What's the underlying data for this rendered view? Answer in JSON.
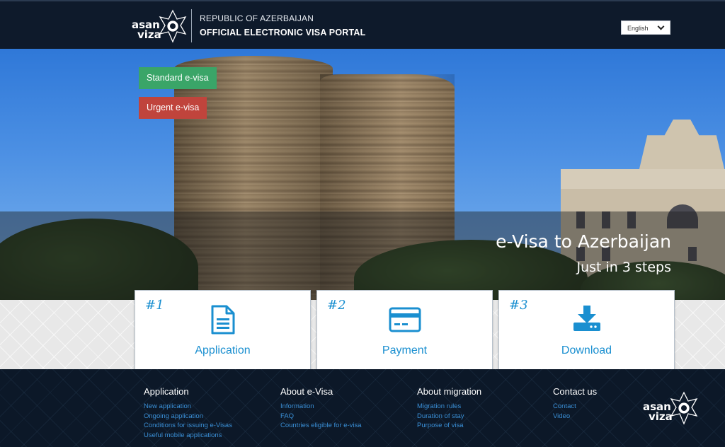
{
  "header": {
    "logo": {
      "line1": "asan",
      "line2": "viza"
    },
    "subtitle": "REPUBLIC OF AZERBAIJAN",
    "title": "OFFICIAL ELECTRONIC VISA PORTAL",
    "language": "English"
  },
  "hero": {
    "standard_button": "Standard e-visa",
    "urgent_button": "Urgent e-visa",
    "title": "e-Visa to Azerbaijan",
    "subtitle": "Just in 3 steps"
  },
  "steps": [
    {
      "num": "#1",
      "label": "Application",
      "icon": "document-icon"
    },
    {
      "num": "#2",
      "label": "Payment",
      "icon": "credit-card-icon"
    },
    {
      "num": "#3",
      "label": "Download",
      "icon": "download-icon"
    }
  ],
  "footer": {
    "columns": [
      {
        "title": "Application",
        "links": [
          "New application",
          "Ongoing application",
          "Conditions for issuing e-Visas",
          "Useful mobile applications"
        ]
      },
      {
        "title": "About e-Visa",
        "links": [
          "Information",
          "FAQ",
          "Countries eligible for e-visa"
        ]
      },
      {
        "title": "About migration",
        "links": [
          "Migration rules",
          "Duration of stay",
          "Purpose of visa"
        ]
      },
      {
        "title": "Contact us",
        "links": [
          "Contact",
          "Video"
        ]
      }
    ],
    "logo": {
      "line1": "asan",
      "line2": "viza"
    }
  },
  "colors": {
    "primary": "#1a8fd0",
    "standard": "#3aa568",
    "urgent": "#c0443c",
    "header_bg": "#0e1a2b"
  }
}
